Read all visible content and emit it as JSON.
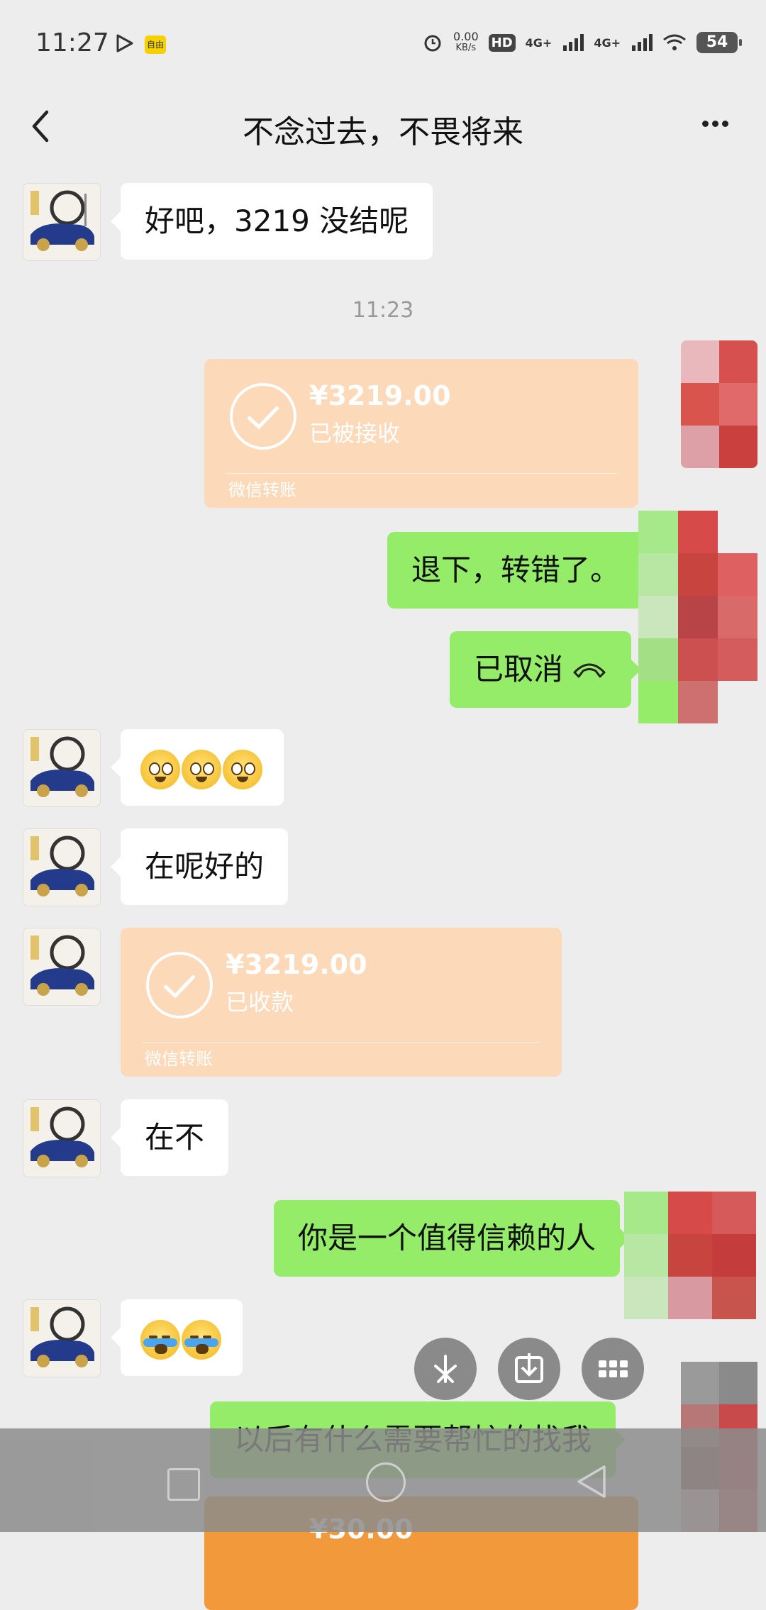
{
  "status_bar": {
    "time": "11:27",
    "app_badge": "自由",
    "net_speed": "0.00",
    "net_unit": "KB/s",
    "hd_label": "HD",
    "net_type_1": "4G+",
    "net_type_2": "4G+",
    "battery": "54"
  },
  "header": {
    "title": "不念过去，不畏将来",
    "back_icon": "chevron-left-icon",
    "more_icon": "more-dots-icon"
  },
  "timestamp": "11:23",
  "messages": {
    "m1": "好吧，3219 没结呢",
    "transfer1": {
      "amount": "¥3219.00",
      "state": "已被接收",
      "label": "微信转账"
    },
    "m2": "退下，转错了。",
    "m3": "已取消",
    "m5": "在呢好的",
    "transfer2": {
      "amount": "¥3219.00",
      "state": "已收款",
      "label": "微信转账"
    },
    "m6": "在不",
    "m7": "你是一个值得信赖的人",
    "m9": "以后有什么需要帮忙的找我",
    "transfer3": {
      "amount": "¥30.00"
    }
  },
  "colors": {
    "background": "#ededed",
    "outgoing_bubble": "#95ec69",
    "incoming_bubble": "#ffffff",
    "transfer_card": "#fcd9b8",
    "transfer_card_pending": "#f29a3b"
  },
  "floating_actions": [
    "sparkle-icon",
    "download-icon",
    "grid-icon"
  ]
}
